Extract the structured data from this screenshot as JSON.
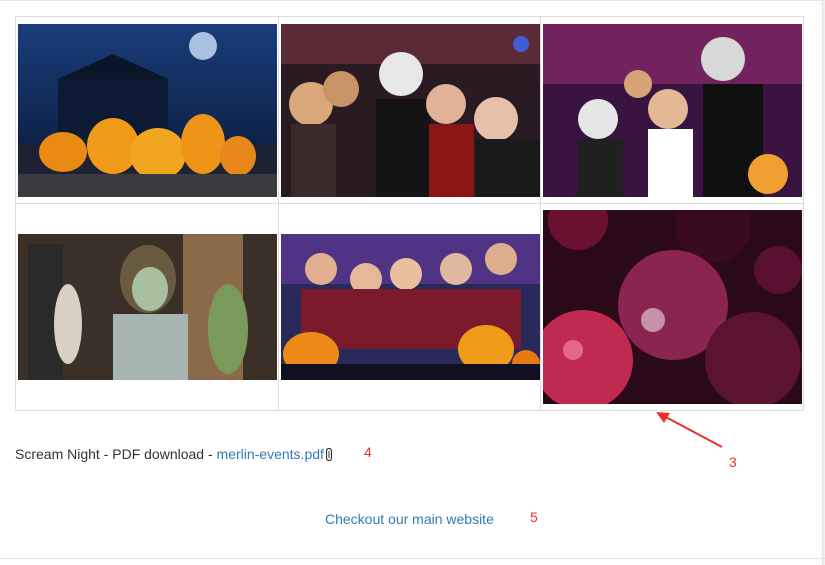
{
  "gallery": {
    "images": [
      {
        "name": "pumpkins-haunted-house-photo"
      },
      {
        "name": "costume-party-skull-photo"
      },
      {
        "name": "face-paint-crowd-photo"
      },
      {
        "name": "zombie-girl-photo"
      },
      {
        "name": "witches-pumpkins-party-photo"
      },
      {
        "name": "disco-balls-photo"
      }
    ]
  },
  "download": {
    "prefix": "Scream Night - PDF download - ",
    "file_link": "merlin-events.pdf"
  },
  "website": {
    "link_text": "Checkout our main website"
  },
  "annotations": {
    "arrow_label": "3",
    "pdf_label": "4",
    "website_label": "5"
  },
  "colors": {
    "link": "#337ab7",
    "annotation": "#e8322b",
    "border": "#dddddd"
  }
}
